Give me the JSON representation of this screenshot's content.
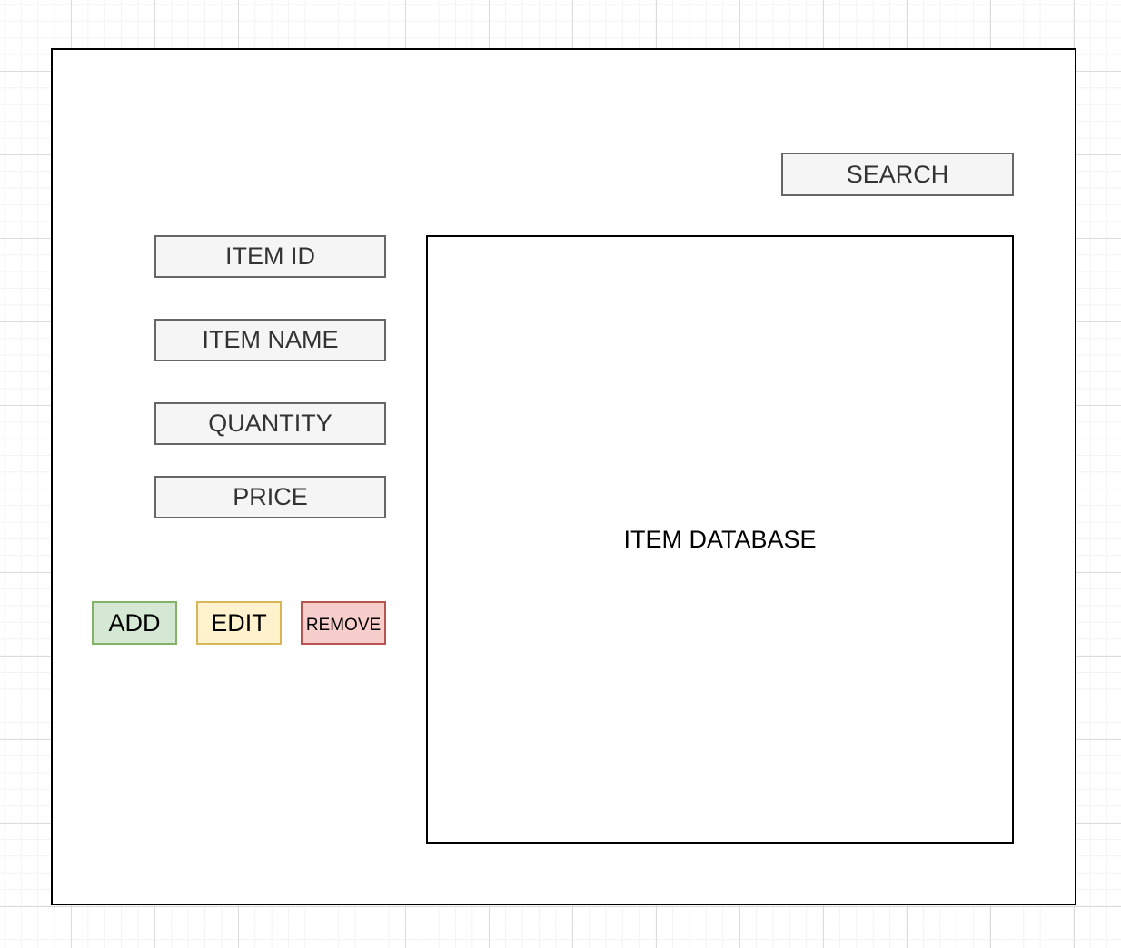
{
  "search": {
    "label": "SEARCH"
  },
  "fields": {
    "item_id": "ITEM ID",
    "item_name": "ITEM NAME",
    "quantity": "QUANTITY",
    "price": "PRICE"
  },
  "actions": {
    "add": "ADD",
    "edit": "EDIT",
    "remove": "REMOVE"
  },
  "database": {
    "label": "ITEM DATABASE"
  },
  "colors": {
    "add_fill": "#d5e8d4",
    "add_border": "#82b366",
    "edit_fill": "#fff2cc",
    "edit_border": "#d6b656",
    "remove_fill": "#f8cecc",
    "remove_border": "#b85450",
    "field_fill": "#f5f5f5",
    "field_border": "#666666"
  }
}
